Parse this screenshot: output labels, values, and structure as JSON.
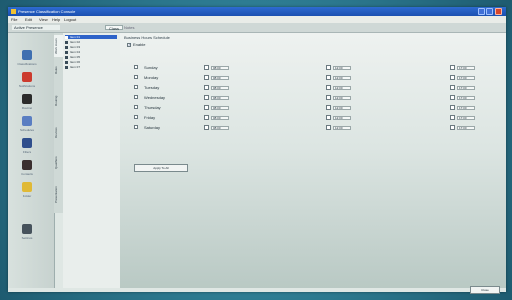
{
  "window": {
    "title": "Presence Classification Console"
  },
  "menu": [
    "File",
    "Edit",
    "View",
    "Help",
    "Logout"
  ],
  "toolbar": {
    "left_label": "Active Presence",
    "tabs": [
      "Class",
      "Notes"
    ]
  },
  "left_nav": [
    {
      "label": "Classifications",
      "icon": "stack-icon",
      "color": "#3f6fb0"
    },
    {
      "label": "Notifications",
      "icon": "alert-icon",
      "color": "#cc3b2e"
    },
    {
      "label": "Routing",
      "icon": "routing-icon",
      "color": "#2b2b2b"
    },
    {
      "label": "Schedules",
      "icon": "calendar-icon",
      "color": "#5a7ec2"
    },
    {
      "label": "Filters",
      "icon": "filter-icon",
      "color": "#2f4e8c"
    },
    {
      "label": "Contacts",
      "icon": "contacts-icon",
      "color": "#3b2f2f"
    },
    {
      "label": "Folder",
      "icon": "folder-icon",
      "color": "#e0b936"
    },
    {
      "label": "Settings",
      "icon": "settings-icon",
      "color": "#46525c"
    }
  ],
  "vertical_tabs": [
    "Work Hours",
    "Rules",
    "Routing",
    "Devices",
    "Qualifiers",
    "Presentation"
  ],
  "tree": {
    "items": [
      "Item 01",
      "Item 02",
      "Item 03",
      "Item 04",
      "Item 05",
      "Item 06",
      "Item 07"
    ]
  },
  "section": {
    "title": "Business Hours Schedule",
    "enable_label": "Enable"
  },
  "schedule": {
    "days": [
      {
        "name": "Sunday",
        "start": "08:00",
        "break": "12:00",
        "end": "17:00"
      },
      {
        "name": "Monday",
        "start": "08:00",
        "break": "12:00",
        "end": "17:00"
      },
      {
        "name": "Tuesday",
        "start": "08:00",
        "break": "12:00",
        "end": "17:00"
      },
      {
        "name": "Wednesday",
        "start": "08:00",
        "break": "12:00",
        "end": "17:00"
      },
      {
        "name": "Thursday",
        "start": "08:00",
        "break": "12:00",
        "end": "17:00"
      },
      {
        "name": "Friday",
        "start": "08:00",
        "break": "12:00",
        "end": "17:00"
      },
      {
        "name": "Saturday",
        "start": "08:00",
        "break": "12:00",
        "end": "17:00"
      }
    ]
  },
  "buttons": {
    "apply": "Apply To All",
    "close": "Close"
  }
}
